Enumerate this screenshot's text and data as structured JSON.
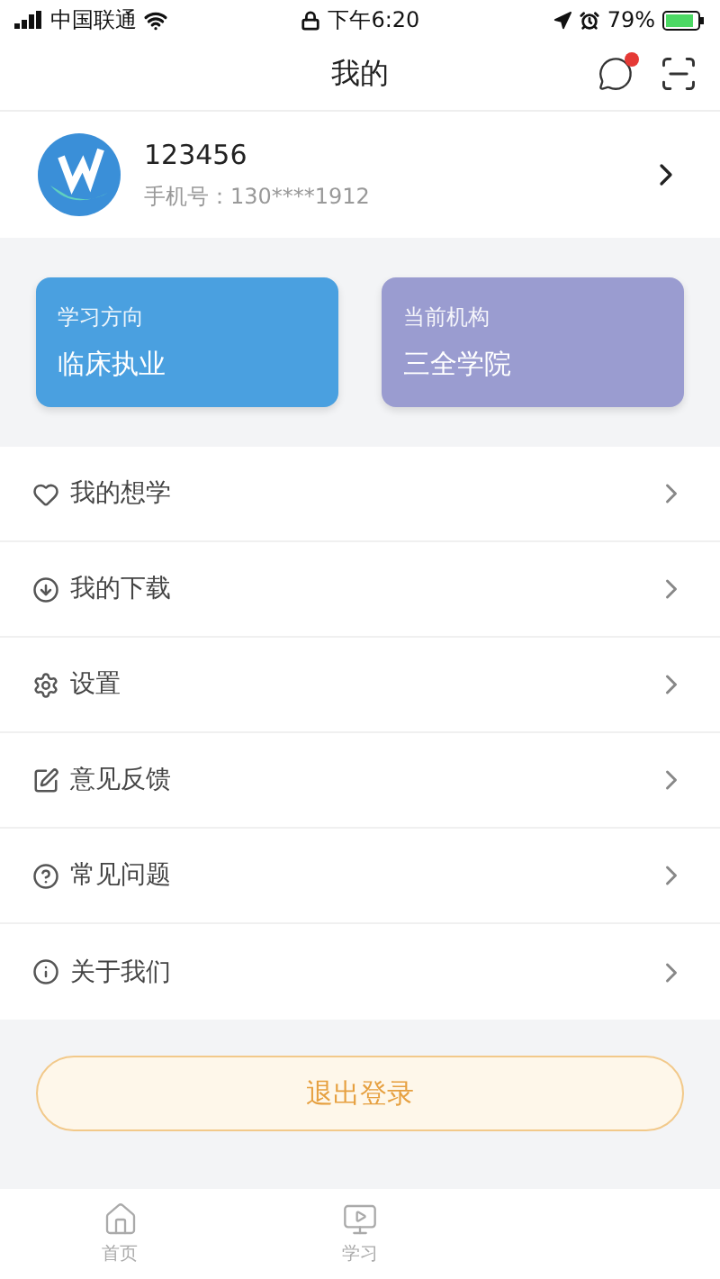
{
  "status_bar": {
    "carrier": "中国联通",
    "time": "下午6:20",
    "battery": "79%"
  },
  "nav": {
    "title": "我的",
    "has_unread": true
  },
  "profile": {
    "name": "123456",
    "phone": "手机号：130****1912"
  },
  "cards": [
    {
      "label": "学习方向",
      "value": "临床执业",
      "color": "#4aa0e0"
    },
    {
      "label": "当前机构",
      "value": "三全学院",
      "color": "#9a9cd0"
    }
  ],
  "menu": [
    {
      "kind": "heart",
      "label": "我的想学"
    },
    {
      "kind": "download",
      "label": "我的下载"
    },
    {
      "kind": "settings",
      "label": "设置"
    },
    {
      "kind": "feedback",
      "label": "意见反馈"
    },
    {
      "kind": "help",
      "label": "常见问题"
    },
    {
      "kind": "info",
      "label": "关于我们"
    }
  ],
  "logout_button": "退出登录",
  "tab_bar": [
    {
      "kind": "home",
      "label": "首页",
      "selected": false
    },
    {
      "kind": "study",
      "label": "学习",
      "selected": false
    }
  ]
}
